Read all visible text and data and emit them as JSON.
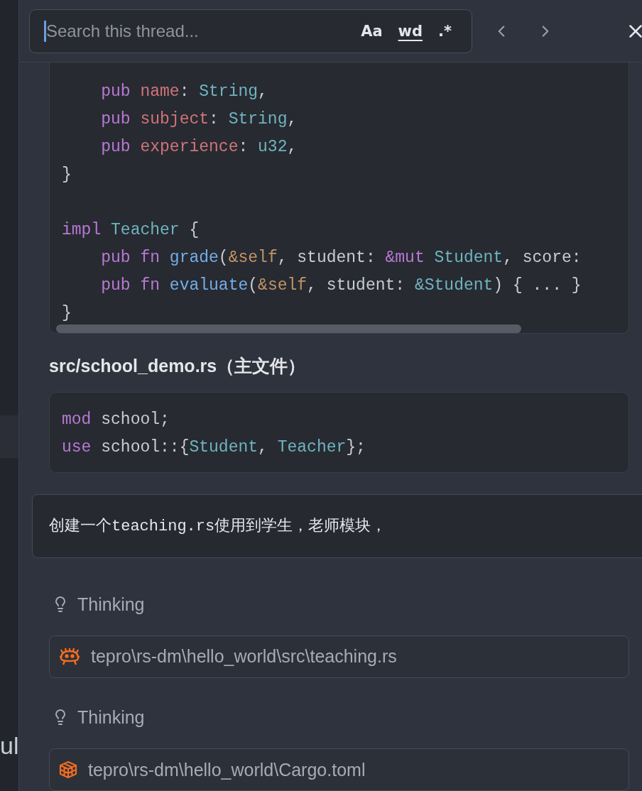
{
  "side_strip": {
    "text": "ul"
  },
  "search": {
    "placeholder": "Search this thread...",
    "toggles": [
      {
        "label": "Aa",
        "kind": "case",
        "selected": false
      },
      {
        "label": "wd",
        "kind": "word",
        "selected": false
      },
      {
        "label": ".*",
        "kind": "regex",
        "selected": false
      }
    ]
  },
  "code_blocks": [
    {
      "scrollbar": true,
      "lines": [
        {
          "kind": "code",
          "tokens": [
            {
              "t": "    pub",
              "color": "#b879d3"
            },
            {
              "t": " name",
              "color": "#d0747a"
            },
            {
              "t": ": ",
              "color": "#c8ccd4"
            },
            {
              "t": "String",
              "color": "#6fb4bf"
            },
            {
              "t": ",",
              "color": "#c8ccd4"
            }
          ]
        },
        {
          "kind": "code",
          "tokens": [
            {
              "t": "    pub",
              "color": "#b879d3"
            },
            {
              "t": " subject",
              "color": "#d0747a"
            },
            {
              "t": ": ",
              "color": "#c8ccd4"
            },
            {
              "t": "String",
              "color": "#6fb4bf"
            },
            {
              "t": ",",
              "color": "#c8ccd4"
            }
          ]
        },
        {
          "kind": "code",
          "tokens": [
            {
              "t": "    pub",
              "color": "#b879d3"
            },
            {
              "t": " experience",
              "color": "#d0747a"
            },
            {
              "t": ": ",
              "color": "#c8ccd4"
            },
            {
              "t": "u32",
              "color": "#6fb4bf"
            },
            {
              "t": ",",
              "color": "#c8ccd4"
            }
          ]
        },
        {
          "kind": "code",
          "tokens": [
            {
              "t": "}",
              "color": "#c8ccd4"
            }
          ]
        },
        {
          "kind": "blank"
        },
        {
          "kind": "code",
          "tokens": [
            {
              "t": "impl",
              "color": "#b879d3"
            },
            {
              "t": " Teacher",
              "color": "#6fb4bf"
            },
            {
              "t": " {",
              "color": "#c8ccd4"
            }
          ]
        },
        {
          "kind": "code",
          "tokens": [
            {
              "t": "    pub fn",
              "color": "#b879d3"
            },
            {
              "t": " grade",
              "color": "#74ade8"
            },
            {
              "t": "(",
              "color": "#c8ccd4"
            },
            {
              "t": "&self",
              "color": "#c19467"
            },
            {
              "t": ", student: ",
              "color": "#c8ccd4"
            },
            {
              "t": "&mut",
              "color": "#b879d3"
            },
            {
              "t": " Student",
              "color": "#6fb4bf"
            },
            {
              "t": ", score:",
              "color": "#c8ccd4"
            }
          ]
        },
        {
          "kind": "code",
          "tokens": [
            {
              "t": "    pub fn",
              "color": "#b879d3"
            },
            {
              "t": " evaluate",
              "color": "#74ade8"
            },
            {
              "t": "(",
              "color": "#c8ccd4"
            },
            {
              "t": "&self",
              "color": "#c19467"
            },
            {
              "t": ", student: ",
              "color": "#c8ccd4"
            },
            {
              "t": "&Student",
              "color": "#6fb4bf"
            },
            {
              "t": ") { ... }",
              "color": "#c8ccd4"
            }
          ]
        },
        {
          "kind": "code",
          "tokens": [
            {
              "t": "}",
              "color": "#c8ccd4"
            }
          ]
        }
      ]
    },
    {
      "heading": "src/school_demo.rs（主文件）",
      "scrollbar": false,
      "lines": [
        {
          "kind": "code",
          "tokens": [
            {
              "t": "mod",
              "color": "#b879d3"
            },
            {
              "t": " school;",
              "color": "#c8ccd4"
            }
          ]
        },
        {
          "kind": "code",
          "tokens": [
            {
              "t": "use",
              "color": "#b879d3"
            },
            {
              "t": " school::{",
              "color": "#c8ccd4"
            },
            {
              "t": "Student",
              "color": "#6fb4bf"
            },
            {
              "t": ", ",
              "color": "#c8ccd4"
            },
            {
              "t": "Teacher",
              "color": "#6fb4bf"
            },
            {
              "t": "};",
              "color": "#c8ccd4"
            }
          ]
        }
      ]
    }
  ],
  "user_message": [
    {
      "t": "创建一个",
      "kind": "text"
    },
    {
      "t": "teaching.rs",
      "kind": "code"
    },
    {
      "t": "使用到学生，老师模块，",
      "kind": "text"
    }
  ],
  "steps": [
    {
      "kind": "thinking",
      "label": "Thinking"
    },
    {
      "kind": "file",
      "path": "tepro\\rs-dm\\hello_world\\src\\teaching.rs"
    },
    {
      "kind": "thinking",
      "label": "Thinking"
    },
    {
      "kind": "file",
      "path": "tepro\\rs-dm\\hello_world\\Cargo.toml"
    }
  ]
}
